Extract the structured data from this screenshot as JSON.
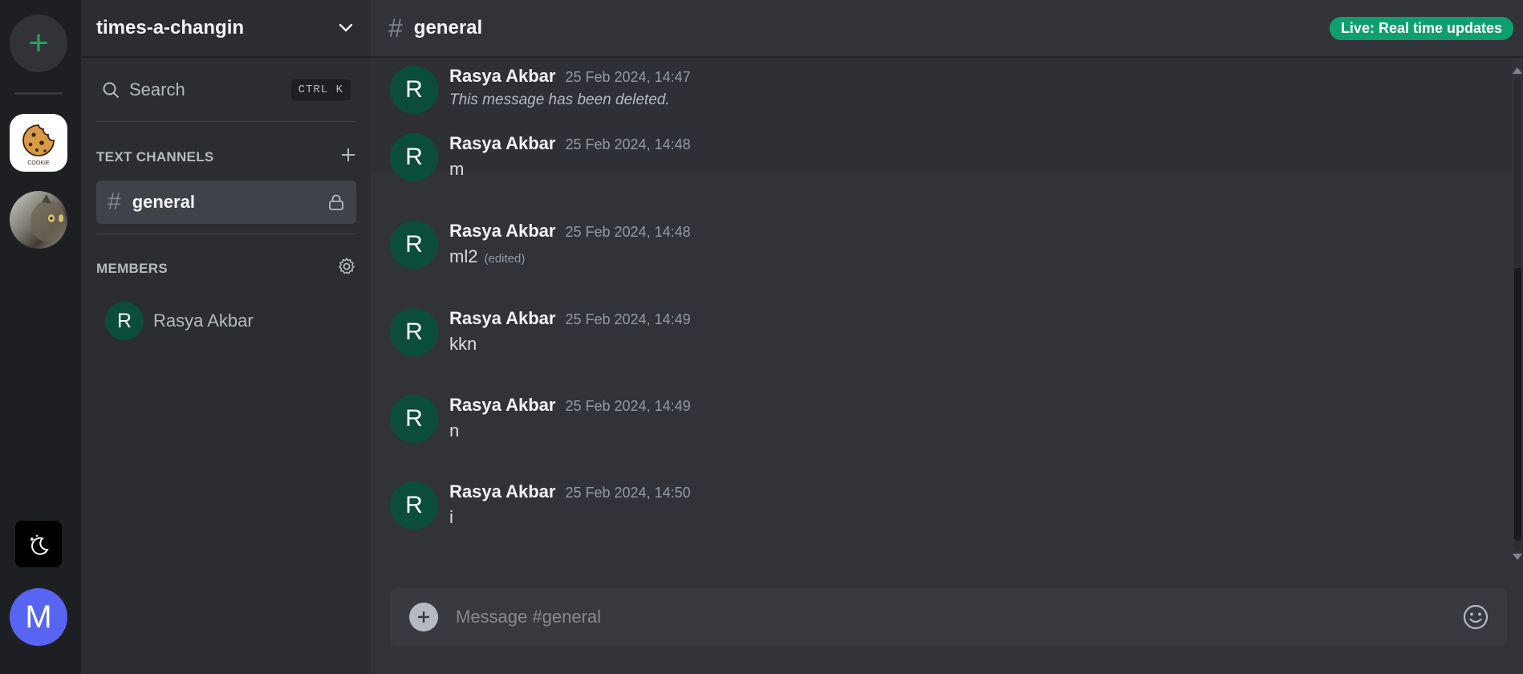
{
  "rail": {
    "add_server_symbol": "+",
    "user_initial": "M",
    "servers": [
      {
        "icon": "cookie-server-icon",
        "label": "COOKIE"
      },
      {
        "icon": "cat-server-icon"
      }
    ],
    "colors": {
      "accent_green": "#23a55a",
      "user_avatar": "#5865f2"
    }
  },
  "sidebar": {
    "server_name": "times-a-changin",
    "search_label": "Search",
    "search_shortcut": "CTRL K",
    "text_channels_title": "TEXT CHANNELS",
    "channel": {
      "hash": "#",
      "name": "general"
    },
    "members_title": "MEMBERS",
    "members": [
      {
        "initial": "R",
        "name": "Rasya Akbar"
      }
    ]
  },
  "main": {
    "channel_hash": "#",
    "channel_name": "general",
    "live_badge": "Live: Real time updates",
    "messages": [
      {
        "initial": "R",
        "author": "Rasya Akbar",
        "time": "25 Feb 2024, 14:47",
        "text": "This message has been deleted.",
        "deleted": true
      },
      {
        "initial": "R",
        "author": "Rasya Akbar",
        "time": "25 Feb 2024, 14:48",
        "text": "m"
      },
      {
        "initial": "R",
        "author": "Rasya Akbar",
        "time": "25 Feb 2024, 14:48",
        "text": "ml2",
        "edited": "(edited)"
      },
      {
        "initial": "R",
        "author": "Rasya Akbar",
        "time": "25 Feb 2024, 14:49",
        "text": "kkn"
      },
      {
        "initial": "R",
        "author": "Rasya Akbar",
        "time": "25 Feb 2024, 14:49",
        "text": "n"
      },
      {
        "initial": "R",
        "author": "Rasya Akbar",
        "time": "25 Feb 2024, 14:50",
        "text": "i"
      }
    ],
    "composer_placeholder": "Message #general",
    "colors": {
      "live_badge": "#0e9f6e",
      "avatar": "#0b4d3b"
    }
  }
}
